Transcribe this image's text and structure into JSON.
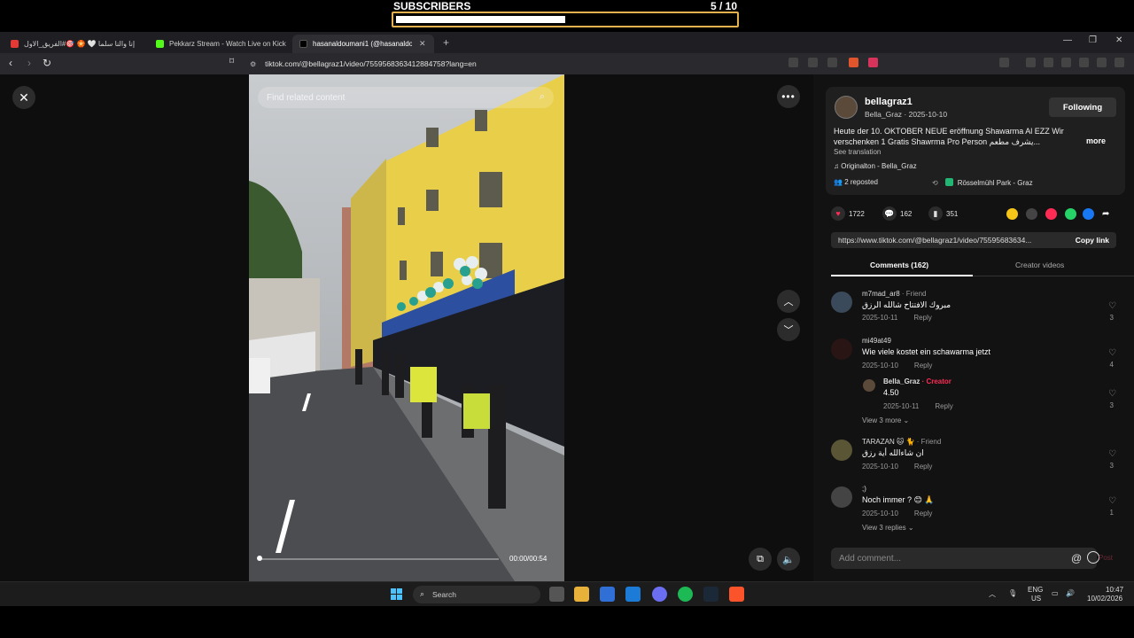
{
  "overlay": {
    "label": "SUBSCRIBERS",
    "count_text": "5  / 10",
    "current": 5,
    "goal": 10
  },
  "browser": {
    "tabs": [
      {
        "title": "إنا والنا سلما 🤍 🏵️ 🎯#الفريق_الاول",
        "favicon_color": "#e53935"
      },
      {
        "title": "Pekkarz Stream - Watch Live on Kick",
        "favicon_color": "#53fc18"
      },
      {
        "title": "hasanaldoumani1 (@hasanaldo...",
        "favicon_color": "#000000",
        "active": true
      }
    ],
    "new_tab_glyph": "+",
    "url": "tiktok.com/@bellagraz1/video/7559568363412884758?lang=en"
  },
  "player": {
    "search_placeholder": "Find related content",
    "time": "00:00/00:54",
    "progress": 0.0
  },
  "post": {
    "author": "bellagraz1",
    "author_sub": "Bella_Graz · 2025-10-10",
    "follow_label": "Following",
    "caption": "Heute der 10. OKTOBER NEUE eröffnung Shawarma Al EZZ Wir verschenken 1 Gratis Shawrma Pro Person يشرف مطعم...",
    "more_label": "more",
    "see_translation": "See translation",
    "music": "♫  Originalton - Bella_Graz",
    "reposted": "2 reposted",
    "location": "Rösselmühl Park - Graz",
    "likes": "1722",
    "comments": "162",
    "saves": "351",
    "link": "https://www.tiktok.com/@bellagraz1/video/75595683634...",
    "copy_link": "Copy link"
  },
  "tabs": {
    "comments": "Comments (162)",
    "creator_videos": "Creator videos"
  },
  "comments": [
    {
      "name": "m7mad_ar8",
      "tag": " · Friend",
      "text": "مبروك الافتتاح شالله الرزق",
      "date": "2025-10-11",
      "reply": "Reply",
      "likes": "3"
    },
    {
      "name": "mi49at49",
      "tag": "",
      "text": "Wie viele kostet ein schawarma jetzt",
      "date": "2025-10-10",
      "reply": "Reply",
      "likes": "4"
    },
    {
      "name": "Bella_Graz",
      "tag": " · Creator",
      "text": "4.50",
      "date": "2025-10-11",
      "reply": "Reply",
      "likes": "3"
    },
    {
      "name": "TARAZAN 🐱 🐈",
      "tag": " · Friend",
      "text": "ان شاءالله أية رزق",
      "date": "2025-10-10",
      "reply": "Reply",
      "likes": "3"
    },
    {
      "name": ";)",
      "tag": "",
      "text": "Noch immer ? 😊 🙏",
      "date": "2025-10-10",
      "reply": "Reply",
      "likes": "1"
    }
  ],
  "view_more": "View 3 more",
  "view_replies": "View 3 replies",
  "comment_input": {
    "placeholder": "Add comment...",
    "post_label": "Post"
  },
  "taskbar": {
    "search_label": "Search",
    "lang_top": "ENG",
    "lang_bottom": "US",
    "time": "10:47",
    "date": "10/02/2026"
  },
  "colors": {
    "accent_red": "#fe2c55",
    "overlay_border": "#e3b24c",
    "windows_blue": "#4cc2ff"
  }
}
